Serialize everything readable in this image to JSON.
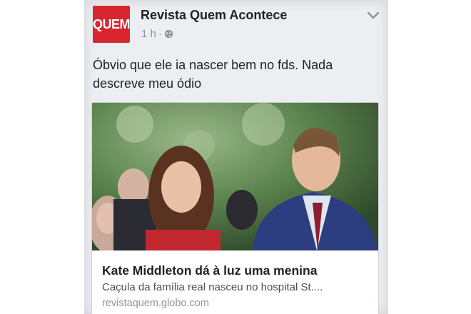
{
  "post": {
    "page_name": "Revista Quem Acontece",
    "avatar_text": "QUEM",
    "time": "1 h",
    "separator": "·",
    "privacy_icon": "globe-icon",
    "menu_icon": "chevron-down-icon",
    "text": "Óbvio que ele ia nascer bem no fds. Nada descreve meu ódio"
  },
  "link": {
    "title": "Kate Middleton dá à luz uma menina",
    "description": "Caçula da família real nasceu no hospital St....",
    "domain": "revistaquem.globo.com"
  },
  "colors": {
    "brand_red": "#d8262e",
    "text_dark": "#1d2129",
    "text_muted": "#8d949e"
  }
}
